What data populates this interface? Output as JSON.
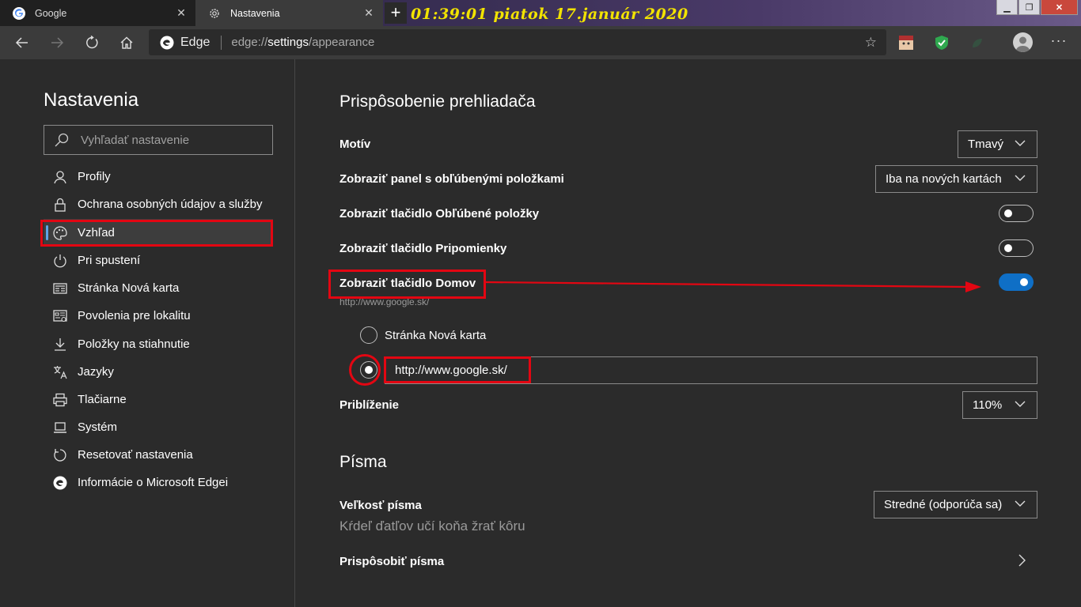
{
  "tabs": [
    {
      "label": "Google",
      "icon": "google-icon"
    },
    {
      "label": "Nastavenia",
      "icon": "gear-icon"
    }
  ],
  "clock_overlay": "01:39:01  piatok 17.január 2020",
  "address_bar": {
    "brand": "Edge",
    "url_prefix": "edge://",
    "url_highlight": "settings",
    "url_suffix": "/appearance"
  },
  "sidebar": {
    "title": "Nastavenia",
    "search_placeholder": "Vyhľadať nastavenie",
    "items": [
      {
        "label": "Profily",
        "icon": "person-icon"
      },
      {
        "label": "Ochrana osobných údajov a služby",
        "icon": "lock-icon"
      },
      {
        "label": "Vzhľad",
        "icon": "palette-icon",
        "selected": true
      },
      {
        "label": "Pri spustení",
        "icon": "power-icon"
      },
      {
        "label": "Stránka Nová karta",
        "icon": "new-tab-page-icon"
      },
      {
        "label": "Povolenia pre lokalitu",
        "icon": "site-permissions-icon"
      },
      {
        "label": "Položky na stiahnutie",
        "icon": "download-icon"
      },
      {
        "label": "Jazyky",
        "icon": "languages-icon"
      },
      {
        "label": "Tlačiarne",
        "icon": "printer-icon"
      },
      {
        "label": "Systém",
        "icon": "laptop-icon"
      },
      {
        "label": "Resetovať nastavenia",
        "icon": "reset-icon"
      },
      {
        "label": "Informácie o Microsoft Edgei",
        "icon": "edge-icon"
      }
    ]
  },
  "main": {
    "section1_title": "Prispôsobenie prehliadača",
    "theme_label": "Motív",
    "theme_value": "Tmavý",
    "fav_bar_label": "Zobraziť panel s obľúbenými položkami",
    "fav_bar_value": "Iba na nových kartách",
    "fav_button_label": "Zobraziť tlačidlo Obľúbené položky",
    "fav_button_on": false,
    "feedback_label": "Zobraziť tlačidlo Pripomienky",
    "feedback_on": false,
    "home_label": "Zobraziť tlačidlo Domov",
    "home_on": true,
    "home_subtext": "http://www.google.sk/",
    "radio_new_tab": "Stránka Nová karta",
    "radio_url_value": "http://www.google.sk/",
    "zoom_label": "Priblíženie",
    "zoom_value": "110%",
    "section2_title": "Písma",
    "font_size_label": "Veľkosť písma",
    "font_size_value": "Stredné (odporúča sa)",
    "font_preview": "Kŕdeľ ďatľov učí koňa žrať kôru",
    "customize_fonts_label": "Prispôsobiť písma"
  },
  "colors": {
    "accent": "#0f6fc6",
    "annotation_red": "#e30612",
    "clock_yellow": "#f2e300"
  }
}
